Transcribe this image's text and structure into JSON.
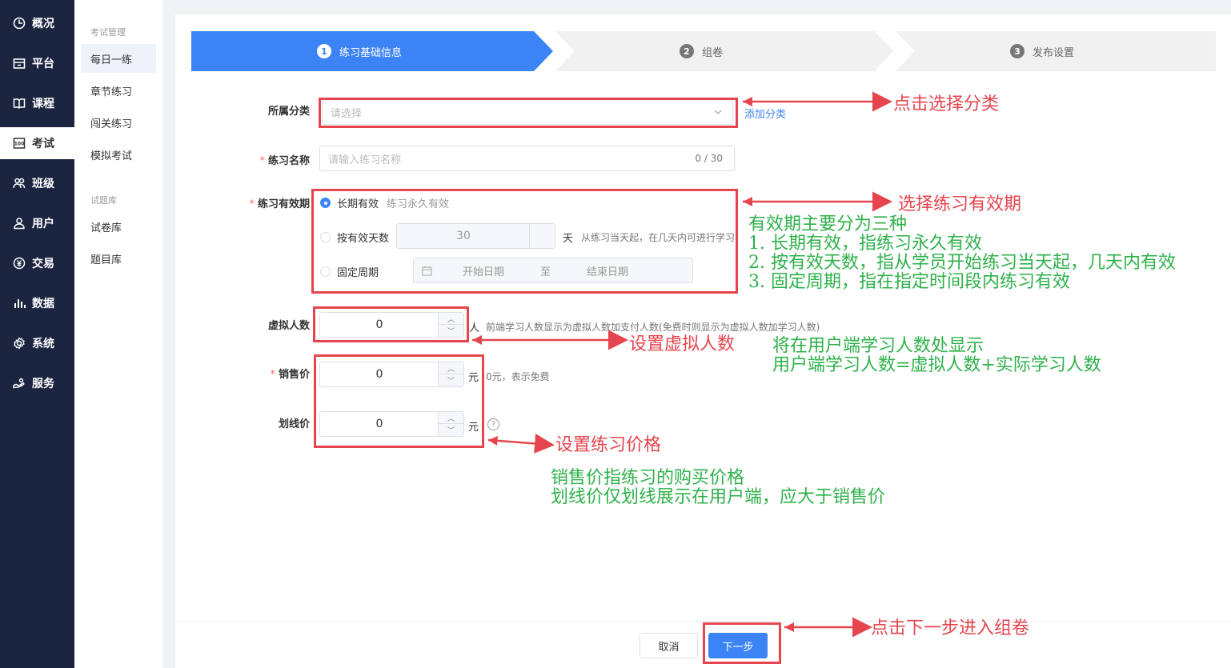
{
  "nav": {
    "items": [
      {
        "label": "概况",
        "icon": "dashboard-icon"
      },
      {
        "label": "平台",
        "icon": "platform-icon"
      },
      {
        "label": "课程",
        "icon": "book-icon"
      },
      {
        "label": "考试",
        "icon": "exam-icon"
      },
      {
        "label": "班级",
        "icon": "class-icon"
      },
      {
        "label": "用户",
        "icon": "user-icon"
      },
      {
        "label": "交易",
        "icon": "yen-icon"
      },
      {
        "label": "数据",
        "icon": "chart-icon"
      },
      {
        "label": "系统",
        "icon": "gear-icon"
      },
      {
        "label": "服务",
        "icon": "service-icon"
      }
    ],
    "active": "考试"
  },
  "subnav": {
    "group1": "考试管理",
    "items1": [
      "每日一练",
      "章节练习",
      "闯关练习",
      "模拟考试"
    ],
    "group2": "试题库",
    "items2": [
      "试卷库",
      "题目库"
    ],
    "active": "每日一练"
  },
  "steps": [
    {
      "num": "1",
      "label": "练习基础信息"
    },
    {
      "num": "2",
      "label": "组卷"
    },
    {
      "num": "3",
      "label": "发布设置"
    }
  ],
  "form": {
    "category_label": "所属分类",
    "category_placeholder": "请选择",
    "add_category": "添加分类",
    "name_label": "练习名称",
    "name_placeholder": "请输入练习名称",
    "name_counter": "0 / 30",
    "validity_label": "练习有效期",
    "opt_long": "长期有效",
    "opt_long_hint": "练习永久有效",
    "opt_days": "按有效天数",
    "days_value": "30",
    "days_unit": "天",
    "days_hint": "从练习当天起，在几天内可进行学习",
    "opt_fixed": "固定周期",
    "start_date": "开始日期",
    "date_sep": "至",
    "end_date": "结束日期",
    "virtual_label": "虚拟人数",
    "virtual_value": "0",
    "virtual_unit": "人",
    "virtual_hint": "前端学习人数显示为虚拟人数加支付人数(免费时则显示为虚拟人数加学习人数)",
    "price_label": "销售价",
    "price_value": "0",
    "price_unit": "元",
    "price_hint": "0元，表示免费",
    "strike_label": "划线价",
    "strike_value": "0",
    "strike_unit": "元",
    "help": "?"
  },
  "buttons": {
    "cancel": "取消",
    "next": "下一步"
  },
  "annotations": {
    "category": "点击选择分类",
    "validity": "选择练习有效期",
    "validity_detail": [
      "有效期主要分为三种",
      "1. 长期有效，指练习永久有效",
      "2. 按有效天数，指从学员开始练习当天起，几天内有效",
      "3. 固定周期，指在指定时间段内练习有效"
    ],
    "virtual": "设置虚拟人数",
    "virtual_detail": [
      "将在用户端学习人数处显示",
      "用户端学习人数=虚拟人数+实际学习人数"
    ],
    "price": "设置练习价格",
    "price_detail": [
      "销售价指练习的购买价格",
      "划线价仅划线展示在用户端，应大于销售价"
    ],
    "next": "点击下一步进入组卷"
  },
  "colors": {
    "accent": "#3c84f5",
    "annotation_red": "#e5454e",
    "annotation_green": "#2eb14a",
    "nav_bg": "#1b2540"
  }
}
